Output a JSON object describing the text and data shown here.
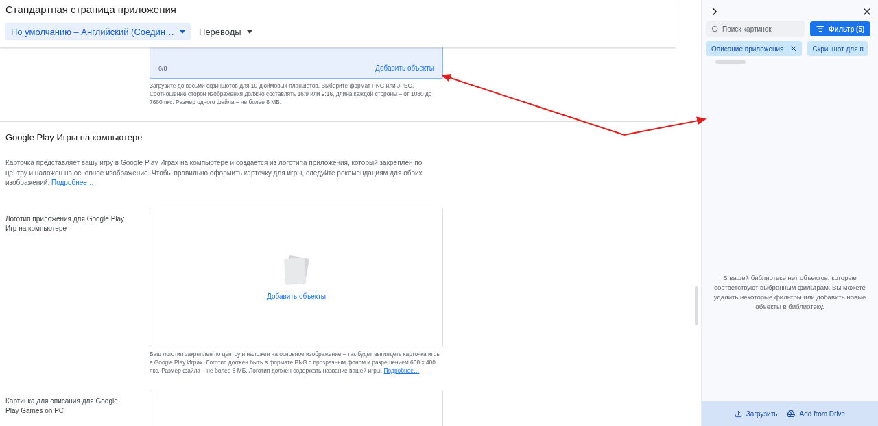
{
  "page": {
    "title": "Стандартная страница приложения",
    "tabs": [
      {
        "label": "По умолчанию – Английский (Соедин…",
        "selected": true
      },
      {
        "label": "Переводы",
        "selected": false
      }
    ]
  },
  "top_upload": {
    "counter": "6/8",
    "action": "Добавить объекты",
    "hint": "Загрузите до восьми скриншотов для 10-дюймовых планшетов. Выберите формат PNG или JPEG. Соотношение сторон изображения должно составлять 16:9 или 9:16, длина каждой стороны – от 1080 до 7680 пкс. Размер одного файла – не более 8 МБ."
  },
  "section": {
    "title": "Google Play Игры на компьютере",
    "description": "Карточка представляет вашу игру в Google Play Играх на компьютере и создается из логотипа приложения, который закреплен по центру и наложен на основное изображение. Чтобы правильно оформить карточку для игры, следуйте рекомендациям для обоих изображений.",
    "link": "Подробнее…"
  },
  "fields": [
    {
      "label": "Логотип приложения для Google Play Игр на компьютере",
      "action": "Добавить объекты",
      "hint": "Ваш логотип закреплен по центру и наложен на основное изображение – так будет выглядеть карточка игры в Google Play Играх. Логотип должен быть в формате PNG с прозрачным фоном и разрешением 600 x 400 пкс. Размер файла – не более 8 МБ. Логотип должен содержать название вашей игры.",
      "link": "Подробнее…"
    },
    {
      "label": "Картинка для описания для Google Play Games on PC"
    }
  ],
  "panel": {
    "search": {
      "placeholder": "Поиск картинок"
    },
    "filter_button": "Фильтр (5)",
    "chips": [
      {
        "label": "Описание приложения",
        "removable": true
      },
      {
        "label": "Скриншот для п",
        "removable": false
      }
    ],
    "empty_message": "В вашей библиотеке нет объектов, которые соответствуют выбранным фильтрам. Вы можете удалить некоторые фильтры или добавить новые объекты в библиотеку.",
    "footer_buttons": [
      {
        "kind": "upload",
        "label": "Загрузить"
      },
      {
        "kind": "drive",
        "label": "Add from Drive"
      }
    ]
  }
}
